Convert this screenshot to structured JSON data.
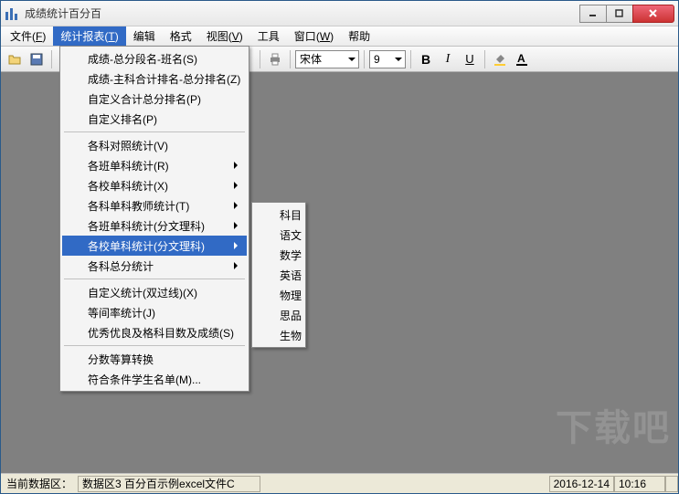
{
  "window": {
    "title": "成绩统计百分百"
  },
  "menubar": {
    "items": [
      {
        "label": "文件",
        "key": "F"
      },
      {
        "label": "统计报表",
        "key": "T"
      },
      {
        "label": "编辑",
        "key": ""
      },
      {
        "label": "格式",
        "key": ""
      },
      {
        "label": "视图",
        "key": "V"
      },
      {
        "label": "工具",
        "key": ""
      },
      {
        "label": "窗口",
        "key": "W"
      },
      {
        "label": "帮助",
        "key": ""
      }
    ]
  },
  "toolbar": {
    "font_name": "宋体",
    "font_size": "9"
  },
  "dropdown": {
    "items": [
      "成绩-总分段名-班名(S)",
      "成绩-主科合计排名-总分排名(Z)",
      "自定义合计总分排名(P)",
      "自定义排名(P)",
      "---",
      "各科对照统计(V)",
      "各班单科统计(R)",
      "各校单科统计(X)",
      "各科单科教师统计(T)",
      "各班单科统计(分文理科)",
      "各校单科统计(分文理科)",
      "各科总分统计",
      "---",
      "自定义统计(双过线)(X)",
      "等间率统计(J)",
      "优秀优良及格科目数及成绩(S)",
      "---",
      "分数等算转换",
      "符合条件学生名单(M)..."
    ],
    "highlight_index": 10
  },
  "submenu": {
    "items": [
      "科目",
      "语文",
      "数学",
      "英语",
      "物理",
      "思品",
      "生物"
    ]
  },
  "statusbar": {
    "label": "当前数据区：",
    "value": "数据区3 百分百示例excel文件C",
    "date": "2016-12-14",
    "time": "10:16"
  },
  "watermark": "下载吧"
}
